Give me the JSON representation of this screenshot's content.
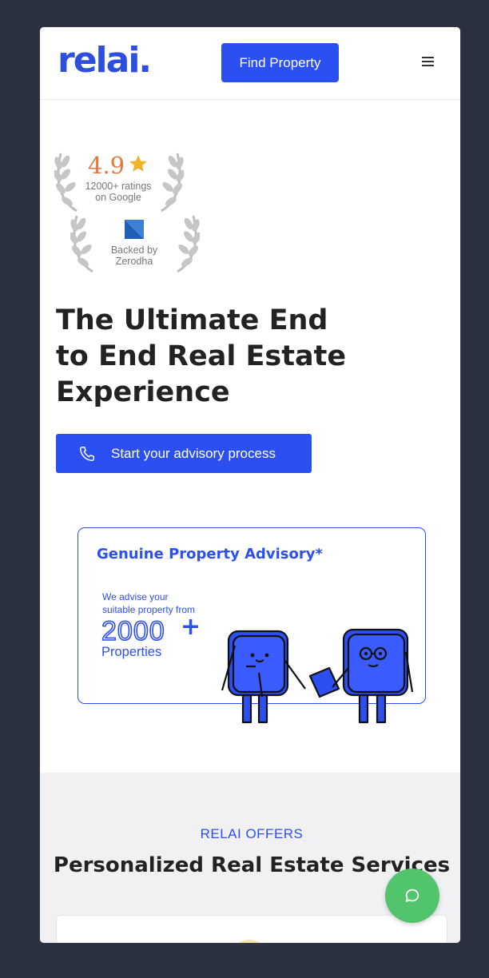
{
  "header": {
    "logo": "relai.",
    "find_property_label": "Find Property",
    "menu_icon": "hamburger-menu-icon"
  },
  "badges": {
    "rating": "4.9",
    "rating_line1": "12000+ ratings",
    "rating_line2": "on Google",
    "backed_line1": "Backed by",
    "backed_line2": "Zerodha"
  },
  "hero": {
    "title_line1": "The Ultimate End",
    "title_line2": "to End Real Estate",
    "title_line3": "Experience",
    "cta_label": "Start your advisory process"
  },
  "promo": {
    "title": "Genuine Property Advisory*",
    "sub_line1": "We advise your",
    "sub_line2": "suitable property from",
    "big_number": "2000",
    "plus": "+",
    "properties": "Properties"
  },
  "offers": {
    "label": "RELAI OFFERS",
    "title": "Personalized Real Estate Services"
  },
  "colors": {
    "brand_blue": "#2c4ff2",
    "chat_green": "#52c46c",
    "page_bg": "#2b3040"
  }
}
